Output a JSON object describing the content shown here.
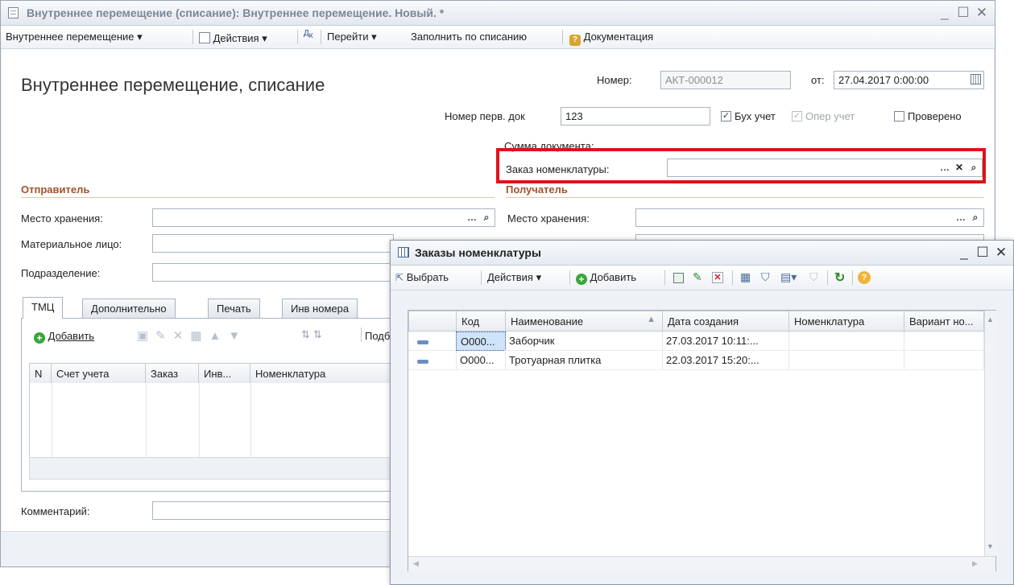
{
  "main_window": {
    "title": "Внутреннее перемещение (списание): Внутреннее перемещение. Новый. *",
    "controls": {
      "minimize": "_",
      "maximize": "☐",
      "close": "✕"
    },
    "toolbar": {
      "doc_menu": "Внутреннее перемещение",
      "actions": "Действия",
      "go_to": "Перейти",
      "fill_by_writeoff": "Заполнить по списанию",
      "documentation": "Документация"
    },
    "form": {
      "heading": "Внутреннее перемещение, списание",
      "number_label": "Номер:",
      "number_value": "АКТ-000012",
      "date_label": "от:",
      "date_value": "27.04.2017  0:00:00",
      "primary_doc_label": "Номер перв. док",
      "primary_doc_value": "123",
      "checks": {
        "accounting": {
          "label": "Бух учет",
          "checked": true
        },
        "operational": {
          "label": "Опер учет",
          "checked": true
        },
        "verified": {
          "label": "Проверено",
          "checked": false
        }
      },
      "doc_sum_label": "Сумма документа:",
      "order_label": "Заказ номенклатуры:",
      "order_value": "",
      "sender": {
        "title": "Отправитель",
        "storage_label": "Место хранения:",
        "responsible_label": "Материальное лицо:",
        "department_label": "Подразделение:"
      },
      "receiver": {
        "title": "Получатель",
        "storage_label": "Место хранения:"
      },
      "tabs": [
        "ТМЦ",
        "Дополнительно",
        "Печать",
        "Инв номера"
      ],
      "tab_toolbar": {
        "add": "Добавить",
        "pick": "Подб"
      },
      "grid_columns": [
        "N",
        "Счет учета",
        "Заказ",
        "Инв...",
        "Номенклатура"
      ],
      "comment_label": "Комментарий:"
    }
  },
  "popup": {
    "title": "Заказы номенклатуры",
    "toolbar": {
      "select": "Выбрать",
      "actions": "Действия",
      "add": "Добавить"
    },
    "columns": [
      "Код",
      "Наименование",
      "Дата создания",
      "Номенклатура",
      "Вариант но..."
    ],
    "rows": [
      {
        "code": "О000...",
        "name": "Заборчик",
        "created": "27.03.2017 10:11:...",
        "nomenclature": "",
        "variant": ""
      },
      {
        "code": "О000...",
        "name": "Тротуарная плитка",
        "created": "22.03.2017 15:20:...",
        "nomenclature": "",
        "variant": ""
      }
    ]
  },
  "colors": {
    "accent_section": "#a0522d",
    "highlight_box": "#e0121b",
    "selection": "#cfe3fb"
  }
}
